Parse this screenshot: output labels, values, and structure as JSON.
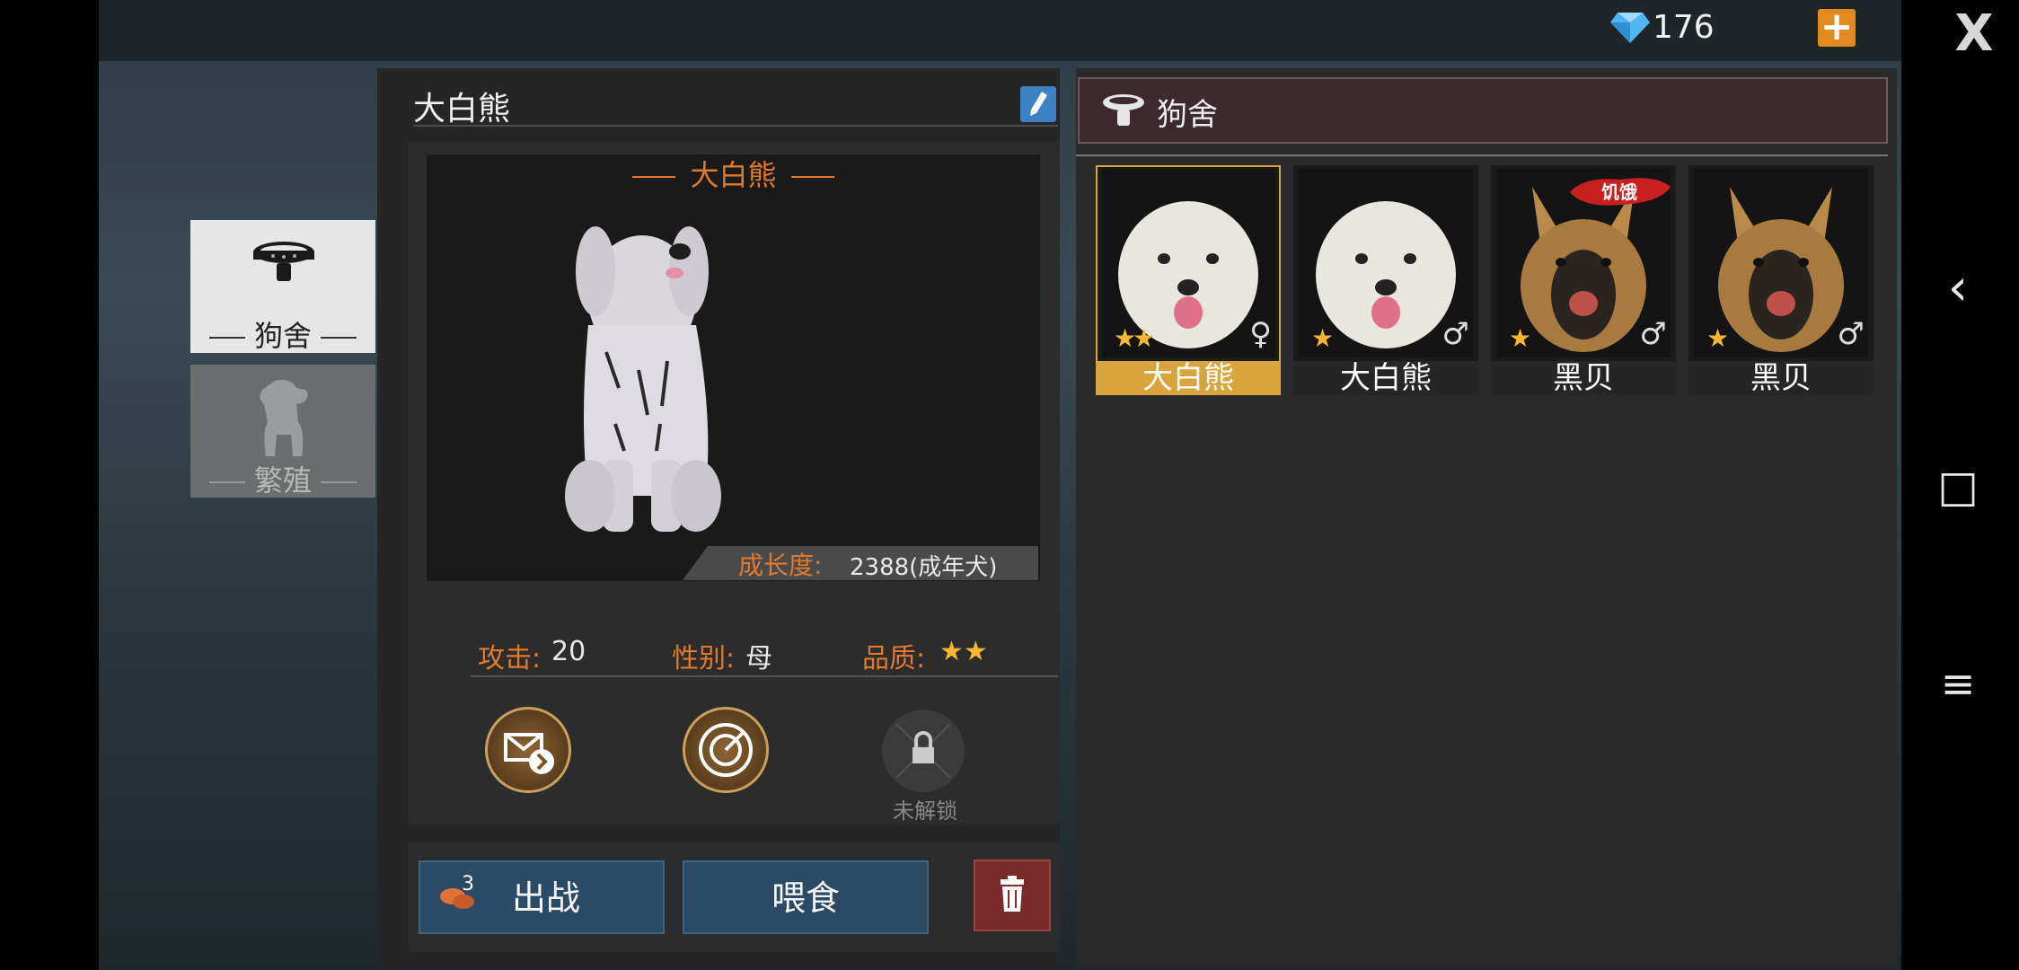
{
  "currency": {
    "icon": "diamond-icon",
    "amount": "176",
    "add_label": "+"
  },
  "close_label": "X",
  "sidebar": {
    "tabs": [
      {
        "label": "狗舍",
        "icon": "dog-collar-icon",
        "active": true
      },
      {
        "label": "繁殖",
        "icon": "puppy-icon",
        "active": false
      }
    ]
  },
  "pet": {
    "name": "大白熊",
    "display_name": "大白熊",
    "growth_label": "成长度:",
    "growth_value": "2388(成年犬)",
    "stats": {
      "attack_label": "攻击:",
      "attack_value": "20",
      "gender_label": "性别:",
      "gender_value": "母",
      "quality_label": "品质:",
      "quality_stars": "★★"
    },
    "locked_label": "未解锁",
    "food_count": "3",
    "deploy_label": "出战",
    "feed_label": "喂食"
  },
  "kennel": {
    "title": "狗舍",
    "dogs": [
      {
        "name": "大白熊",
        "stars": "★★",
        "gender": "♀",
        "breed": "great-pyrenees",
        "selected": true,
        "hungry": false
      },
      {
        "name": "大白熊",
        "stars": "★",
        "gender": "♂",
        "breed": "great-pyrenees",
        "selected": false,
        "hungry": false
      },
      {
        "name": "黑贝",
        "stars": "★",
        "gender": "♂",
        "breed": "german-shepherd",
        "selected": false,
        "hungry": true,
        "hungry_label": "饥饿"
      },
      {
        "name": "黑贝",
        "stars": "★",
        "gender": "♂",
        "breed": "german-shepherd",
        "selected": false,
        "hungry": false
      }
    ]
  },
  "system_nav": {
    "back": "‹",
    "home": "□",
    "menu": "≡"
  },
  "colors": {
    "accent_orange": "#e07a2e",
    "selected_gold": "#d8a43b",
    "button_blue": "#2a4a66",
    "delete_red": "#7a2a2a"
  }
}
